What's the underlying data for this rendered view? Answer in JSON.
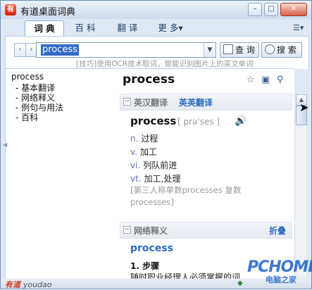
{
  "window": {
    "title": "有道桌面词典",
    "logo_letter": "有",
    "controls": [
      "–",
      "□",
      "✕"
    ]
  },
  "tabs": [
    {
      "label": "词 典",
      "active": true
    },
    {
      "label": "百 科",
      "active": false
    },
    {
      "label": "翻 译",
      "active": false
    },
    {
      "label": "更 多▾",
      "active": false
    }
  ],
  "search": {
    "value": "process",
    "lookup_label": "查 询",
    "search_label": "搜 索",
    "tip": "[技巧]使用OCR技术取词，智能识别图片上的英文单词"
  },
  "tree": {
    "root": "process",
    "items": [
      "- 基本翻译",
      "- 网络释义",
      "- 例句与用法",
      "- 百科"
    ]
  },
  "entry": {
    "word": "process",
    "section1_label": "英汉翻译",
    "section1_alt": "英英翻译",
    "headword": "process",
    "phonetic": "[ prə'ses ]",
    "definitions": [
      {
        "pos": "n.",
        "text": "过程"
      },
      {
        "pos": "v.",
        "text": "加工"
      },
      {
        "pos": "vi.",
        "text": "列队前进"
      },
      {
        "pos": "vt.",
        "text": "加工,处理"
      }
    ],
    "forms": "[第三人称单数processes 复数processes]",
    "section2_label": "网络释义",
    "section2_fold": "折叠",
    "net_word": "process",
    "net_item": "1. 步骤",
    "net_text": "随时职业经理人必须掌握的词"
  },
  "status": {
    "brand": "有道",
    "brand_sub": "youdao"
  },
  "watermark": {
    "main": "PCHOME",
    "sub": "电脑之家"
  }
}
